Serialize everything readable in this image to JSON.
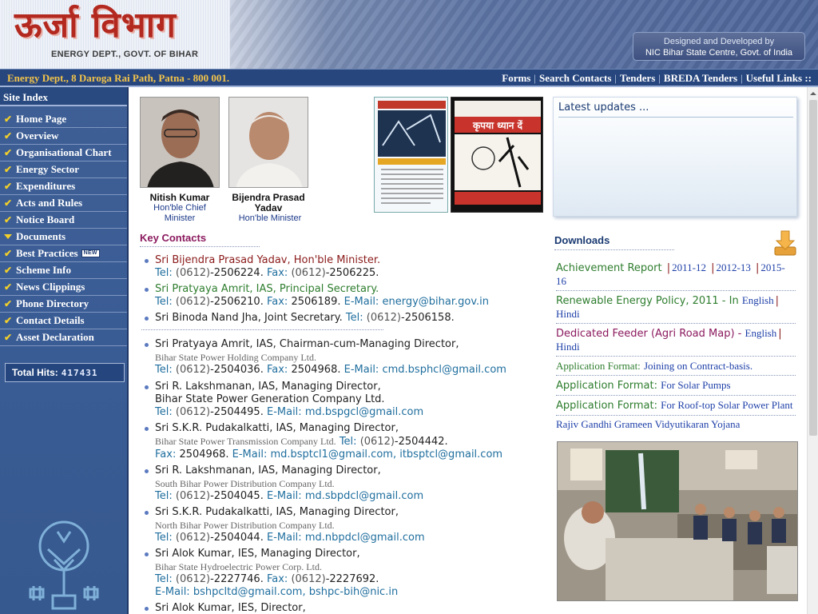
{
  "header": {
    "logo_hindi": "ऊर्जा विभाग",
    "logo_english": "ENERGY DEPT., GOVT. OF BIHAR",
    "designed_line1": "Designed and Developed by",
    "designed_line2": "NIC Bihar State Centre, Govt. of India"
  },
  "navbar": {
    "address": "Energy Dept., 8 Daroga Rai Path, Patna - 800 001.",
    "links": [
      "Forms",
      "Search Contacts",
      "Tenders",
      "BREDA Tenders",
      "Useful Links ::"
    ]
  },
  "sidebar": {
    "title": "Site Index",
    "items": [
      {
        "label": "Home Page",
        "icon": "check-icon"
      },
      {
        "label": "Overview",
        "icon": "check-icon"
      },
      {
        "label": "Organisational Chart",
        "icon": "check-icon"
      },
      {
        "label": "Energy Sector",
        "icon": "check-icon"
      },
      {
        "label": "Expenditures",
        "icon": "check-icon"
      },
      {
        "label": "Acts and Rules",
        "icon": "check-icon"
      },
      {
        "label": "Notice Board",
        "icon": "check-icon"
      },
      {
        "label": "Documents",
        "icon": "triangle-down-icon"
      },
      {
        "label": "Best Practices",
        "icon": "check-icon",
        "badge": "NEW"
      },
      {
        "label": "Scheme Info",
        "icon": "check-icon"
      },
      {
        "label": "News Clippings",
        "icon": "check-icon"
      },
      {
        "label": "Phone Directory",
        "icon": "check-icon"
      },
      {
        "label": "Contact Details",
        "icon": "check-icon"
      },
      {
        "label": "Asset Declaration",
        "icon": "check-icon"
      }
    ],
    "hits_label": "Total Hits:",
    "hits_value": "417431"
  },
  "leaders": [
    {
      "name": "Nitish Kumar",
      "role_line1": "Hon'ble Chief",
      "role_line2": "Minister"
    },
    {
      "name_line1": "Bijendra Prasad",
      "name_line2": "Yadav",
      "role": "Hon'ble Minister"
    }
  ],
  "key_contacts": {
    "title": "Key Contacts",
    "c1": {
      "name": "Sri Bijendra Prasad Yadav, Hon'ble Minister.",
      "tel_label": "Tel:",
      "tel_code": "(0612)",
      "tel": "-2506224.",
      "fax_label": "Fax:",
      "fax_code": "(0612)",
      "fax": "-2506225."
    },
    "c2": {
      "name": "Sri Pratyaya Amrit, IAS, Principal Secretary.",
      "tel_label": "Tel:",
      "tel_code": "(0612)",
      "tel": "-2506210.",
      "fax_label": "Fax:",
      "fax": "2506189.",
      "email_label": "E-Mail:",
      "email": "energy@bihar.gov.in"
    },
    "c3": {
      "name": "Sri Binoda Nand Jha, Joint Secretary.",
      "tel_label": "Tel:",
      "tel_code": "(0612)",
      "tel": "-2506158."
    },
    "c4": {
      "name": "Sri Pratyaya Amrit, IAS, Chairman-cum-Managing Director,",
      "org": "Bihar State Power Holding Company Ltd.",
      "tel_label": "Tel:",
      "tel_code": "(0612)",
      "tel": "-2504036.",
      "fax_label": "Fax:",
      "fax": "2504968.",
      "email_label": "E-Mail:",
      "email": "cmd.bsphcl@gmail.com"
    },
    "c5": {
      "name": "Sri R. Lakshmanan, IAS, Managing Director,",
      "org": "Bihar State Power Generation Company Ltd.",
      "tel_label": "Tel:",
      "tel_code": "(0612)",
      "tel": "-2504495.",
      "email_label": "E-Mail:",
      "email": "md.bspgcl@gmail.com"
    },
    "c6": {
      "name": "Sri S.K.R. Pudakalkatti, IAS, Managing Director,",
      "org": "Bihar State Power Transmission Company Ltd.",
      "tel_label": "Tel:",
      "tel_code": "(0612)",
      "tel": "-2504442.",
      "fax_label": "Fax:",
      "fax": "2504968.",
      "email_label": "E-Mail:",
      "email": "md.bsptcl1@gmail.com,",
      "email2": "itbsptcl@gmail.com"
    },
    "c7": {
      "name": "Sri R. Lakshmanan, IAS, Managing Director,",
      "org": "South Bihar Power Distribution Company Ltd.",
      "tel_label": "Tel:",
      "tel_code": "(0612)",
      "tel": "-2504045.",
      "email_label": "E-Mail:",
      "email": "md.sbpdcl@gmail.com"
    },
    "c8": {
      "name": "Sri S.K.R. Pudakalkatti, IAS, Managing Director,",
      "org": "North Bihar Power Distribution Company Ltd.",
      "tel_label": "Tel:",
      "tel_code": "(0612)",
      "tel": "-2504044.",
      "email_label": "E-Mail:",
      "email": "md.nbpdcl@gmail.com"
    },
    "c9": {
      "name": "Sri Alok Kumar, IES, Managing Director,",
      "org": "Bihar State Hydroelectric Power Corp. Ltd.",
      "tel_label": "Tel:",
      "tel_code": "(0612)",
      "tel": "-2227746.",
      "fax_label": "Fax:",
      "fax_code": "(0612)",
      "fax": "-2227692.",
      "email_label": "E-Mail:",
      "email": "bshpcltd@gmail.com,",
      "email2": "bshpc-bih@nic.in"
    },
    "c10": {
      "name": "Sri Alok Kumar, IES, Director,"
    }
  },
  "updates": {
    "title": "Latest updates ..."
  },
  "downloads": {
    "title": "Downloads",
    "d1": {
      "label": "Achievement Report",
      "y1": "2011-12",
      "y2": "2012-13",
      "y3": "2015-",
      "y3b": "16"
    },
    "d2": {
      "label": "Renewable Energy Policy, 2011 - In",
      "en": "English",
      "hi": "Hindi"
    },
    "d3": {
      "label": "Dedicated Feeder (Agri Road Map)",
      "dash": "-",
      "en": "English",
      "hi": "Hindi"
    },
    "d4": {
      "label": "Application Format:",
      "link": "Joining on Contract-basis."
    },
    "d5": {
      "label": "Application Format:",
      "link": "For Solar Pumps"
    },
    "d6": {
      "label": "Application Format:",
      "link": "For Roof-top Solar Power Plant"
    },
    "d7": {
      "link": "Rajiv Gandhi Grameen Vidyutikaran Yojana"
    }
  },
  "poster2_text": "कृपया ध्यान दें",
  "colors": {
    "nav_bg": "#27467e",
    "address": "#f3c44a",
    "sidebar_bg": "#3a5c95",
    "accent_magenta": "#8b1a5e",
    "link_blue": "#1d3fa8"
  }
}
